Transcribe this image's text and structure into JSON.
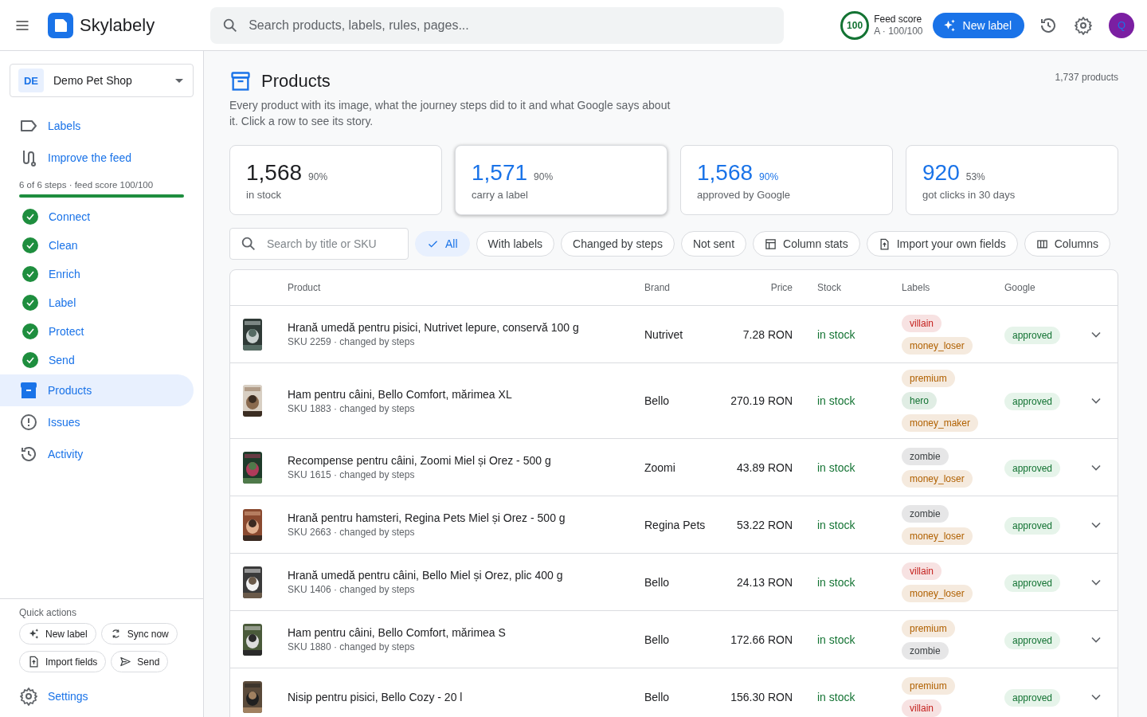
{
  "header": {
    "brand": "Skylabely",
    "search_placeholder": "Search products, labels, rules, pages...",
    "score_value": "100",
    "score_title": "Feed score",
    "score_detail": "A · 100/100",
    "new_label": "New label",
    "avatar": "Q"
  },
  "sidebar": {
    "shop_badge": "DE",
    "shop_name": "Demo Pet Shop",
    "nav_top": [
      {
        "label": "Labels"
      },
      {
        "label": "Improve the feed"
      }
    ],
    "progress_text": "6 of 6 steps · feed score 100/100",
    "progress": {
      "level": 1.0
    },
    "steps": [
      {
        "label": "Connect",
        "done": true
      },
      {
        "label": "Clean",
        "done": true
      },
      {
        "label": "Enrich",
        "done": true
      },
      {
        "label": "Label",
        "done": true
      },
      {
        "label": "Protect",
        "done": true
      },
      {
        "label": "Send",
        "done": true
      }
    ],
    "nav": [
      {
        "label": "Products",
        "selected": true
      },
      {
        "label": "Issues",
        "selected": false
      },
      {
        "label": "Activity",
        "selected": false
      }
    ],
    "quick_title": "Quick actions",
    "quick_actions": [
      "New label",
      "Sync now",
      "Import fields",
      "Send"
    ],
    "settings": "Settings"
  },
  "page": {
    "title": "Products",
    "count": "1,737 products",
    "description": "Every product with its image, what the journey steps did to it and what Google says about it. Click a row to see its story.",
    "stats": [
      {
        "value": "1,568",
        "percent": "90%",
        "label": "in stock",
        "accent": false,
        "selected": false
      },
      {
        "value": "1,571",
        "percent": "90%",
        "label": "carry a label",
        "accent": true,
        "selected": true
      },
      {
        "value": "1,568",
        "percent": "90%",
        "label": "approved by Google",
        "accent": true,
        "selected": false
      },
      {
        "value": "920",
        "percent": "53%",
        "label": "got clicks in 30 days",
        "accent": true,
        "selected": false
      }
    ],
    "search_placeholder": "Search by title or SKU",
    "filters": [
      {
        "label": "All",
        "selected": true
      },
      {
        "label": "With labels",
        "selected": false
      },
      {
        "label": "Changed by steps",
        "selected": false
      },
      {
        "label": "Not sent",
        "selected": false
      }
    ],
    "actions": [
      "Column stats",
      "Import your own fields",
      "Columns"
    ]
  },
  "table": {
    "columns": [
      "Product",
      "Brand",
      "Price",
      "Stock",
      "Labels",
      "Google"
    ],
    "rows": [
      {
        "title": "Hrană umedă pentru pisici, Nutrivet lepure, conservă 100 g",
        "meta": "SKU 2259 · changed by steps",
        "brand": "Nutrivet",
        "price": "7.28 RON",
        "stock": "in stock",
        "labels": [
          {
            "text": "villain",
            "color": "#c5221f"
          },
          {
            "text": "money_loser",
            "color": "#b06000"
          }
        ],
        "google": "approved"
      },
      {
        "title": "Ham pentru câini, Bello Comfort, mărimea XL",
        "meta": "SKU 1883 · changed by steps",
        "brand": "Bello",
        "price": "270.19 RON",
        "stock": "in stock",
        "labels": [
          {
            "text": "premium",
            "color": "#b06000"
          },
          {
            "text": "hero",
            "color": "#137333"
          },
          {
            "text": "money_maker",
            "color": "#b06000"
          }
        ],
        "google": "approved"
      },
      {
        "title": "Recompense pentru câini, Zoomi Miel și Orez - 500 g",
        "meta": "SKU 1615 · changed by steps",
        "brand": "Zoomi",
        "price": "43.89 RON",
        "stock": "in stock",
        "labels": [
          {
            "text": "zombie",
            "color": "#3c4043"
          },
          {
            "text": "money_loser",
            "color": "#b06000"
          }
        ],
        "google": "approved"
      },
      {
        "title": "Hrană pentru hamsteri, Regina Pets Miel și Orez - 500 g",
        "meta": "SKU 2663 · changed by steps",
        "brand": "Regina Pets",
        "price": "53.22 RON",
        "stock": "in stock",
        "labels": [
          {
            "text": "zombie",
            "color": "#3c4043"
          },
          {
            "text": "money_loser",
            "color": "#b06000"
          }
        ],
        "google": "approved"
      },
      {
        "title": "Hrană umedă pentru câini, Bello Miel și Orez, plic 400 g",
        "meta": "SKU 1406 · changed by steps",
        "brand": "Bello",
        "price": "24.13 RON",
        "stock": "in stock",
        "labels": [
          {
            "text": "villain",
            "color": "#c5221f"
          },
          {
            "text": "money_loser",
            "color": "#b06000"
          }
        ],
        "google": "approved"
      },
      {
        "title": "Ham pentru câini, Bello Comfort, mărimea S",
        "meta": "SKU 1880 · changed by steps",
        "brand": "Bello",
        "price": "172.66 RON",
        "stock": "in stock",
        "labels": [
          {
            "text": "premium",
            "color": "#b06000"
          },
          {
            "text": "zombie",
            "color": "#3c4043"
          }
        ],
        "google": "approved"
      },
      {
        "title": "Nisip pentru pisici, Bello Cozy - 20 l",
        "brand": "Bello",
        "price": "156.30 RON",
        "stock": "in stock",
        "labels": [
          {
            "text": "premium",
            "color": "#b06000"
          },
          {
            "text": "villain",
            "color": "#c5221f"
          }
        ],
        "google": "approved"
      }
    ]
  }
}
